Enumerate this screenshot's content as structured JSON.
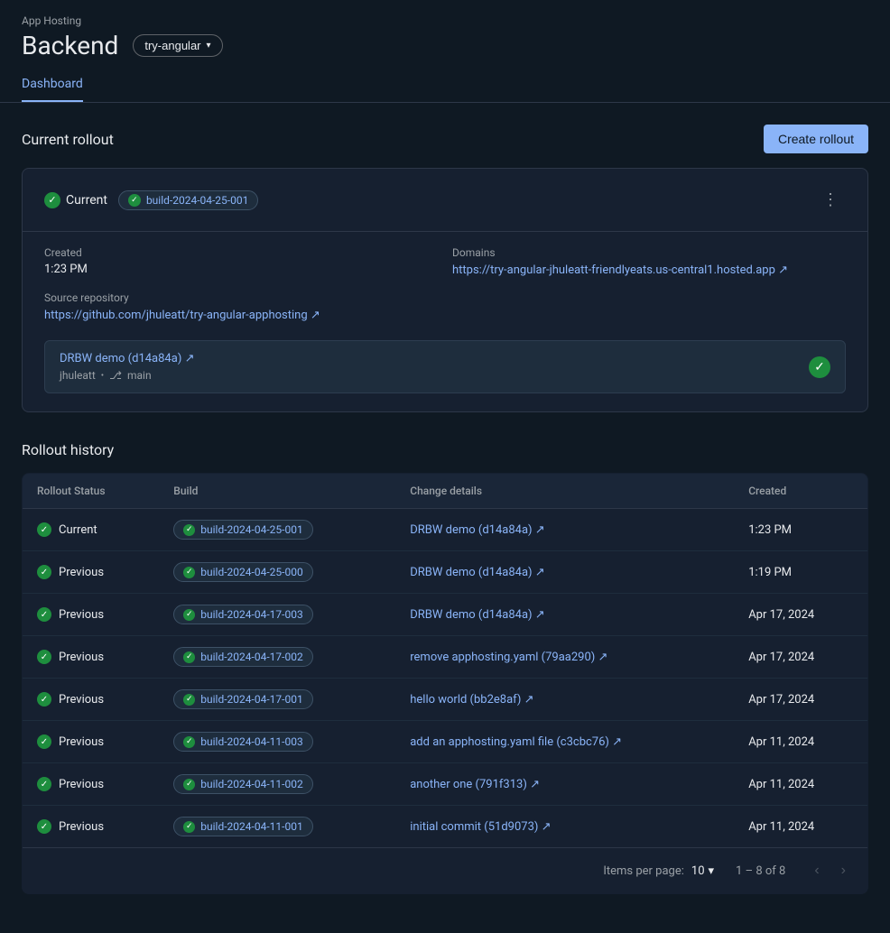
{
  "app": {
    "hosting_label": "App Hosting",
    "title": "Backend",
    "branch": "try-angular"
  },
  "tabs": [
    {
      "label": "Dashboard",
      "active": true
    }
  ],
  "current_rollout": {
    "section_title": "Current rollout",
    "create_btn": "Create rollout",
    "status": "Current",
    "build_id": "build-2024-04-25-001",
    "more_icon": "⋮",
    "created_label": "Created",
    "created_value": "1:23 PM",
    "source_repo_label": "Source repository",
    "source_repo_url": "https://github.com/jhuleatt/try-angular-apphosting",
    "source_repo_display": "https://github.com/jhuleatt/try-angular-apphosting ↗",
    "domains_label": "Domains",
    "domains_url": "https://try-angular-jhuleatt-friendlyeats.us-central1.hosted.app",
    "domains_display": "https://try-angular-jhuleatt-friendlyeats.us-central1.hosted.app ↗",
    "commit_link_text": "DRBW demo (d14a84a) ↗",
    "commit_user": "jhuleatt",
    "commit_branch": "main",
    "check_icon": "✓"
  },
  "rollout_history": {
    "title": "Rollout history",
    "columns": [
      "Rollout Status",
      "Build",
      "Change details",
      "Created"
    ],
    "rows": [
      {
        "status": "Current",
        "build": "build-2024-04-25-001",
        "change": "DRBW demo (d14a84a)",
        "created": "1:23 PM"
      },
      {
        "status": "Previous",
        "build": "build-2024-04-25-000",
        "change": "DRBW demo (d14a84a)",
        "created": "1:19 PM"
      },
      {
        "status": "Previous",
        "build": "build-2024-04-17-003",
        "change": "DRBW demo (d14a84a)",
        "created": "Apr 17, 2024"
      },
      {
        "status": "Previous",
        "build": "build-2024-04-17-002",
        "change": "remove apphosting.yaml (79aa290)",
        "created": "Apr 17, 2024"
      },
      {
        "status": "Previous",
        "build": "build-2024-04-17-001",
        "change": "hello world (bb2e8af)",
        "created": "Apr 17, 2024"
      },
      {
        "status": "Previous",
        "build": "build-2024-04-11-003",
        "change": "add an apphosting.yaml file (c3cbc76)",
        "created": "Apr 11, 2024"
      },
      {
        "status": "Previous",
        "build": "build-2024-04-11-002",
        "change": "another one (791f313)",
        "created": "Apr 11, 2024"
      },
      {
        "status": "Previous",
        "build": "build-2024-04-11-001",
        "change": "initial commit (51d9073)",
        "created": "Apr 11, 2024"
      }
    ],
    "pagination": {
      "items_per_page_label": "Items per page:",
      "items_per_page_value": "10",
      "range_label": "1 – 8 of 8"
    }
  }
}
